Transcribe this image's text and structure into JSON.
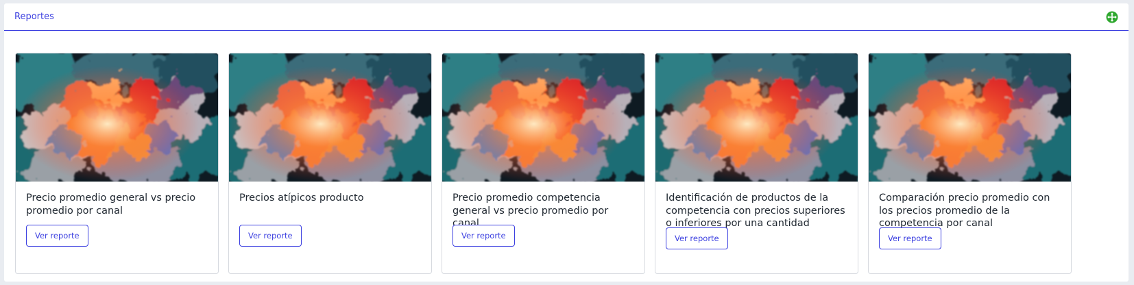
{
  "panel": {
    "title": "Reportes",
    "expand_icon": "expand-arrows-icon",
    "accent_color": "#3b3fe0",
    "icon_color": "#2fa82f"
  },
  "cards": [
    {
      "title": "Precio promedio general vs precio promedio por canal",
      "button_label": "Ver reporte",
      "image": "abstract-colorful-smoke-image"
    },
    {
      "title": "Precios atípicos producto",
      "button_label": "Ver reporte",
      "image": "abstract-colorful-smoke-image"
    },
    {
      "title": "Precio promedio competencia general vs precio promedio por canal",
      "button_label": "Ver reporte",
      "image": "abstract-colorful-smoke-image"
    },
    {
      "title": "Identificación de productos de la competencia con precios superiores o inferiores por una cantidad",
      "button_label": "Ver reporte",
      "image": "abstract-colorful-smoke-image"
    },
    {
      "title": "Comparación precio promedio con los precios promedio de la competencia por canal",
      "button_label": "Ver reporte",
      "image": "abstract-colorful-smoke-image"
    }
  ]
}
